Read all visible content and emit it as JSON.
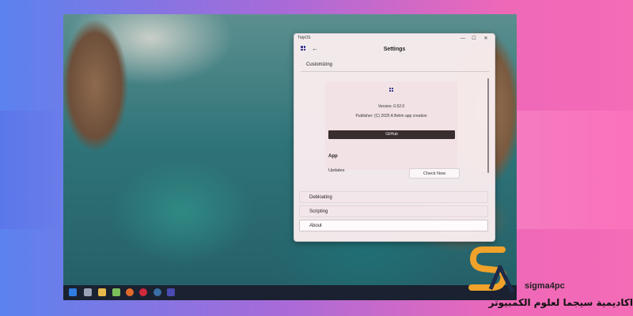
{
  "window": {
    "app_name": "TidyOS",
    "title": "Settings",
    "controls": {
      "minimize": "—",
      "maximize": "☐",
      "close": "✕"
    }
  },
  "section": {
    "customizing": "Customizing"
  },
  "about_card": {
    "version": "Version: 0.52.0",
    "publisher": "Publisher: (C) 2025 A Belim app creation",
    "github_label": "GitHub"
  },
  "app_section": {
    "heading": "App",
    "updates_label": "Updates",
    "check_label": "Check Now"
  },
  "nav": [
    {
      "label": "Debloating"
    },
    {
      "label": "Scripting"
    },
    {
      "label": "About"
    }
  ],
  "taskbar_icons": [
    "windows-start-icon",
    "file-explorer-icon",
    "folder-icon",
    "notepad-icon",
    "firefox-icon",
    "opera-icon",
    "steam-icon",
    "tidyos-app-icon"
  ],
  "watermark": {
    "brand": "sigma4pc",
    "arabic": "اكاديمية سيجما لعلوم الكمبيوتر"
  }
}
